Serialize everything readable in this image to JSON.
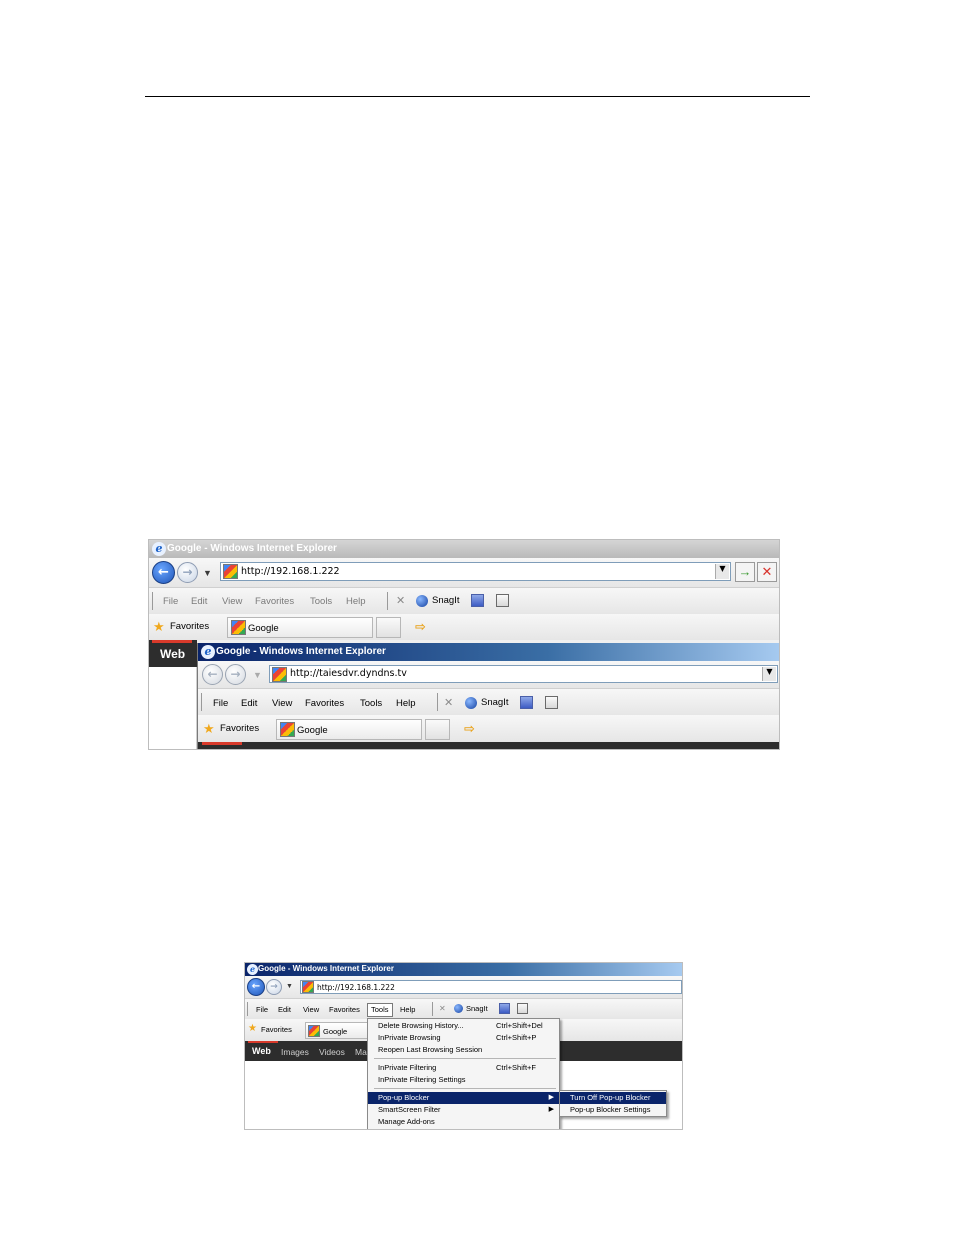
{
  "screenshot1": {
    "back_window": {
      "title": "Google - Windows Internet Explorer",
      "address": "http://192.168.1.222",
      "menu": [
        "File",
        "Edit",
        "View",
        "Favorites",
        "Tools",
        "Help"
      ],
      "snagit_label": "SnagIt",
      "favorites_label": "Favorites",
      "fav_tab_label": "Google",
      "web_label": "Web"
    },
    "front_window": {
      "title": "Google - Windows Internet Explorer",
      "address": "http://taiesdvr.dyndns.tv",
      "menu": [
        "File",
        "Edit",
        "View",
        "Favorites",
        "Tools",
        "Help"
      ],
      "snagit_label": "SnagIt",
      "favorites_label": "Favorites",
      "fav_tab_label": "Google"
    }
  },
  "screenshot2": {
    "title": "Google - Windows Internet Explorer",
    "address": "http://192.168.1.222",
    "menu": [
      "File",
      "Edit",
      "View",
      "Favorites",
      "Tools",
      "Help"
    ],
    "snagit_label": "SnagIt",
    "favorites_label": "Favorites",
    "fav_tab_label": "Google",
    "google_bar": [
      "Web",
      "Images",
      "Videos",
      "Ma"
    ],
    "tools_menu": {
      "items": [
        {
          "label": "Delete Browsing History...",
          "shortcut": "Ctrl+Shift+Del"
        },
        {
          "label": "InPrivate Browsing",
          "shortcut": "Ctrl+Shift+P"
        },
        {
          "label": "Reopen Last Browsing Session",
          "shortcut": ""
        },
        {
          "label": "InPrivate Filtering",
          "shortcut": "Ctrl+Shift+F"
        },
        {
          "label": "InPrivate Filtering Settings",
          "shortcut": ""
        },
        {
          "label": "Pop-up Blocker",
          "shortcut": ""
        },
        {
          "label": "SmartScreen Filter",
          "shortcut": ""
        },
        {
          "label": "Manage Add-ons",
          "shortcut": ""
        }
      ],
      "selected": "Pop-up Blocker"
    },
    "popup_submenu": {
      "items": [
        "Turn Off Pop-up Blocker",
        "Pop-up Blocker Settings"
      ],
      "selected": "Turn Off Pop-up Blocker"
    }
  },
  "colors": {
    "active_title": "#0a246a",
    "menu_highlight": "#0a246a",
    "google_dark_bar": "#2d2d2d",
    "google_red": "#d93a2b"
  }
}
